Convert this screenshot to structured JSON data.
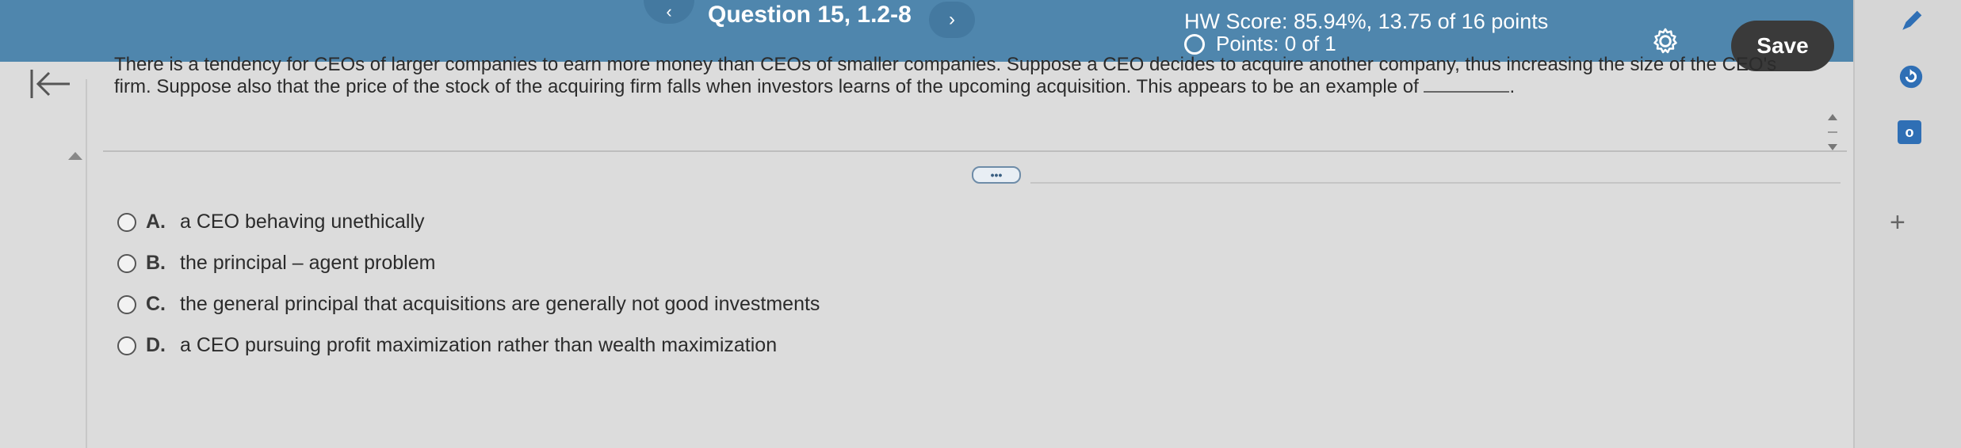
{
  "header": {
    "prev_glyph": "‹",
    "question_title": "Question 15, 1.2-8",
    "next_glyph": "›",
    "hw_score": "HW Score: 85.94%, 13.75 of 16 points",
    "points": "Points: 0 of 1",
    "save_label": "Save"
  },
  "question": {
    "text": "There is a tendency for CEOs of larger companies to earn more money than CEOs of smaller companies. Suppose a CEO decides to acquire another company, thus increasing the size of the CEO's firm. Suppose also that the price of the stock of the acquiring firm falls when investors learns of the upcoming acquisition. This appears to be an example of",
    "after_blank": "."
  },
  "more_handle": "•••",
  "options": [
    {
      "letter": "A.",
      "text": "a CEO behaving unethically"
    },
    {
      "letter": "B.",
      "text": "the principal – agent problem"
    },
    {
      "letter": "C.",
      "text": "the general principal that acquisitions are generally not good investments"
    },
    {
      "letter": "D.",
      "text": "a CEO pursuing profit maximization rather than wealth maximization"
    }
  ],
  "rail": {
    "plus": "+",
    "badge_letter": "o"
  },
  "colors": {
    "header": "#4f86ad",
    "save_button": "#3a3a3a",
    "rail_icon": "#2f6fb5"
  }
}
